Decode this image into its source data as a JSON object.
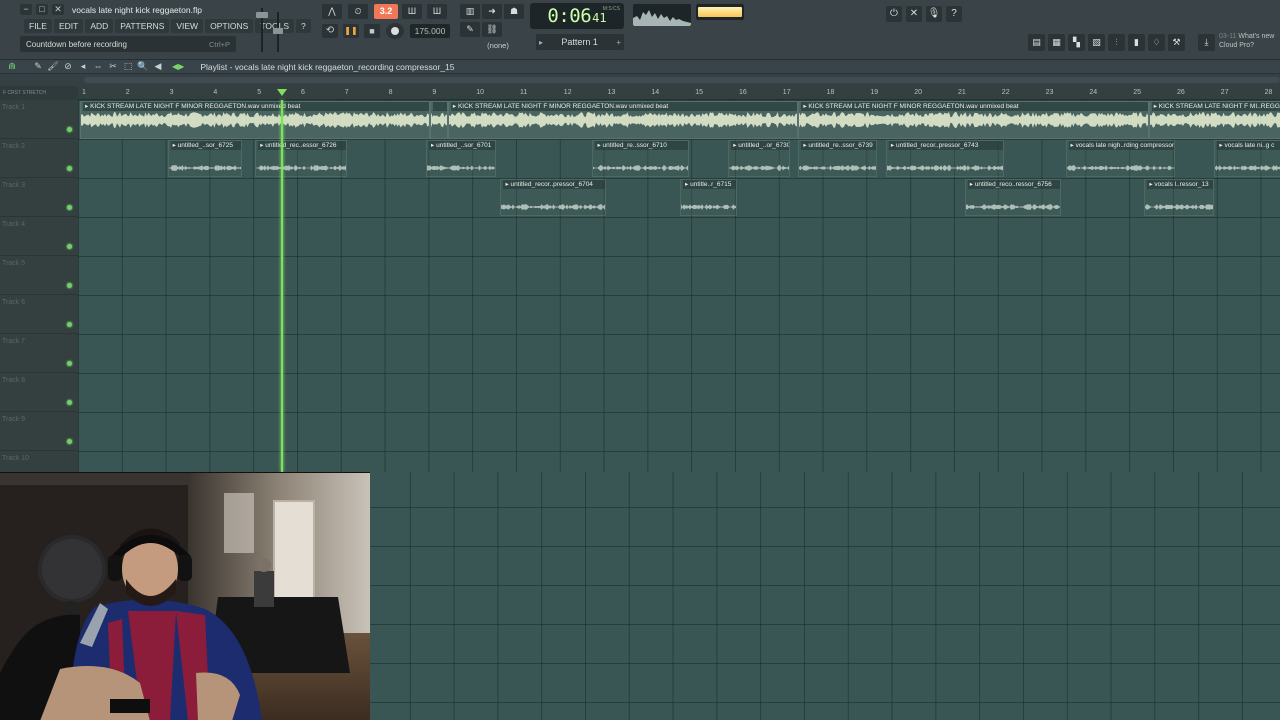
{
  "window": {
    "file_title": "vocals late night kick reggaeton.flp",
    "controls": [
      "−",
      "□",
      "✕"
    ]
  },
  "menu": [
    "FILE",
    "EDIT",
    "ADD",
    "PATTERNS",
    "VIEW",
    "OPTIONS",
    "TOOLS",
    "?"
  ],
  "hint": {
    "text": "Countdown before recording",
    "shortcut": "Ctrl+P"
  },
  "transport": {
    "countdown_label": "3.2",
    "tempo": "175.000",
    "snap": "(none)",
    "time_main": "0:06",
    "time_cs": "41",
    "time_unit": "M:S:CS",
    "pattern": "Pattern 1"
  },
  "news": {
    "line1_num": "03-11",
    "line1": "What's new",
    "line2": "Cloud Pro?"
  },
  "playlist": {
    "title": "Playlist - vocals late night kick reggaeton_recording compressor_15",
    "time_sig": "F CRST STRETCH",
    "bar_numbers": [
      "1",
      "2",
      "3",
      "4",
      "5",
      "6",
      "7",
      "8",
      "9",
      "10",
      "11",
      "12",
      "13",
      "14",
      "15",
      "16",
      "17",
      "18",
      "19",
      "20",
      "21",
      "22",
      "23",
      "24",
      "25",
      "26",
      "27",
      "28"
    ],
    "tracks": [
      "Track 1",
      "Track 2",
      "Track 3",
      "Track 4",
      "Track 5",
      "Track 6",
      "Track 7",
      "Track 8",
      "Track 9",
      "Track 10"
    ],
    "playhead_bar": 5.6,
    "clips": [
      {
        "track": 0,
        "start": 1,
        "end": 9.0,
        "name": "KICK STREAM LATE NIGHT F MINOR REGGAETON.wav unmixed beat",
        "kind": "beat"
      },
      {
        "track": 0,
        "start": 9.0,
        "end": 9.4,
        "name": "",
        "kind": "beat"
      },
      {
        "track": 0,
        "start": 9.4,
        "end": 17.4,
        "name": "KICK STREAM LATE NIGHT F MINOR REGGAETON.wav unmixed beat",
        "kind": "beat"
      },
      {
        "track": 0,
        "start": 17.4,
        "end": 25.4,
        "name": "KICK STREAM LATE NIGHT F MINOR REGGAETON.wav unmixed beat",
        "kind": "beat"
      },
      {
        "track": 0,
        "start": 25.4,
        "end": 28.7,
        "name": "KICK STREAM LATE NIGHT F MI..REGGAETON",
        "kind": "beat"
      },
      {
        "track": 1,
        "start": 3.0,
        "end": 4.7,
        "name": "untitled_..sor_6725",
        "kind": "vocal"
      },
      {
        "track": 1,
        "start": 5.0,
        "end": 7.1,
        "name": "untitled_rec..essor_6726",
        "kind": "vocal"
      },
      {
        "track": 1,
        "start": 8.9,
        "end": 10.5,
        "name": "untitled_..sor_6701",
        "kind": "vocal"
      },
      {
        "track": 1,
        "start": 12.7,
        "end": 14.9,
        "name": "untitled_re..ssor_6710",
        "kind": "vocal"
      },
      {
        "track": 1,
        "start": 15.8,
        "end": 17.2,
        "name": "untitled_..or_6730",
        "kind": "vocal"
      },
      {
        "track": 1,
        "start": 17.4,
        "end": 19.2,
        "name": "untitled_re..ssor_6739",
        "kind": "vocal"
      },
      {
        "track": 1,
        "start": 19.4,
        "end": 22.1,
        "name": "untitled_recor..pressor_6743",
        "kind": "vocal"
      },
      {
        "track": 1,
        "start": 23.5,
        "end": 26.0,
        "name": "vocals late nigh..rding compressor_7",
        "kind": "vocal"
      },
      {
        "track": 1,
        "start": 26.9,
        "end": 28.7,
        "name": "vocals late ni..g c",
        "kind": "vocal"
      },
      {
        "track": 2,
        "start": 10.6,
        "end": 13.0,
        "name": "untitled_recor..pressor_6704",
        "kind": "vocal"
      },
      {
        "track": 2,
        "start": 14.7,
        "end": 16.0,
        "name": "untitle..r_6715",
        "kind": "vocal"
      },
      {
        "track": 2,
        "start": 21.2,
        "end": 23.4,
        "name": "untitled_reco..ressor_6756",
        "kind": "vocal"
      },
      {
        "track": 2,
        "start": 25.3,
        "end": 26.9,
        "name": "vocals l..ressor_13",
        "kind": "vocal"
      }
    ]
  },
  "colors": {
    "grid": "#3a5654",
    "playhead": "#7fe05c",
    "lcd": "#c9ffa6",
    "countdown": "#f07858"
  }
}
